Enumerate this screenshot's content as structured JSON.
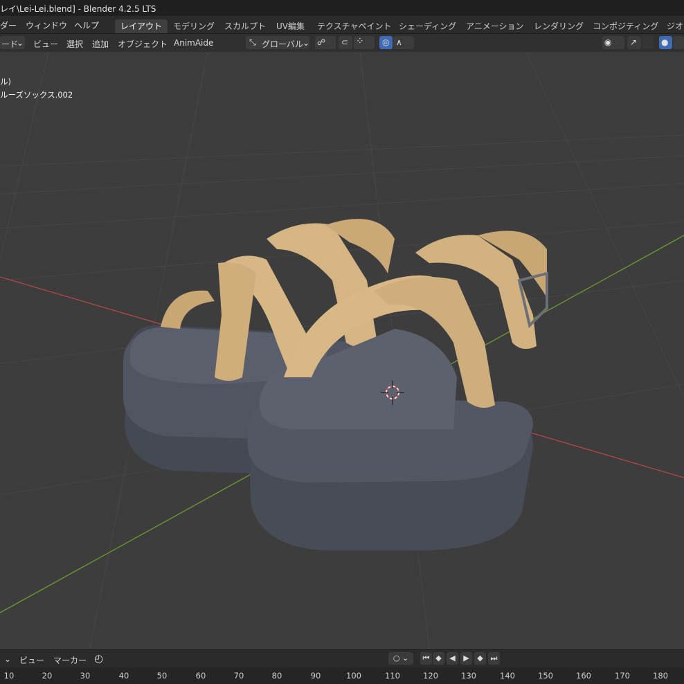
{
  "window": {
    "title": "レイ\\Lei-Lei.blend] - Blender 4.2.5 LTS"
  },
  "menus": [
    "ダー",
    "ウィンドウ",
    "ヘルプ"
  ],
  "workspaces": {
    "tabs": [
      "レイアウト",
      "モデリング",
      "スカルプト",
      "UV編集",
      "テクスチャペイント",
      "シェーディング",
      "アニメーション",
      "レンダリング",
      "コンポジティング",
      "ジオ"
    ],
    "active": "レイアウト"
  },
  "header": {
    "mode": "ード",
    "view": "ビュー",
    "select": "選択",
    "add": "追加",
    "object": "オブジェクト",
    "addon": "AnimAide",
    "orientation": "グローバル"
  },
  "viewport_info": {
    "line1": "ル)",
    "line2": "ルーズソックス.002"
  },
  "timeline": {
    "view": "ビュー",
    "marker": "マーカー",
    "frames": [
      "10",
      "20",
      "30",
      "40",
      "50",
      "60",
      "70",
      "80",
      "90",
      "100",
      "110",
      "120",
      "130",
      "140",
      "150",
      "160",
      "170",
      "180"
    ]
  },
  "colors": {
    "strap": "#d3b17f",
    "sole": "#4b4f58",
    "x_axis": "#c04545",
    "y_axis": "#6a9a2e",
    "active_accent": "#3f6bb2"
  },
  "icons": [
    "transform-orientation-icon",
    "snap-icon",
    "proportional-edit-icon",
    "visibility-icon",
    "gizmo-icon",
    "shading-solid-icon",
    "3d-cursor-icon",
    "sync-clock-icon"
  ]
}
